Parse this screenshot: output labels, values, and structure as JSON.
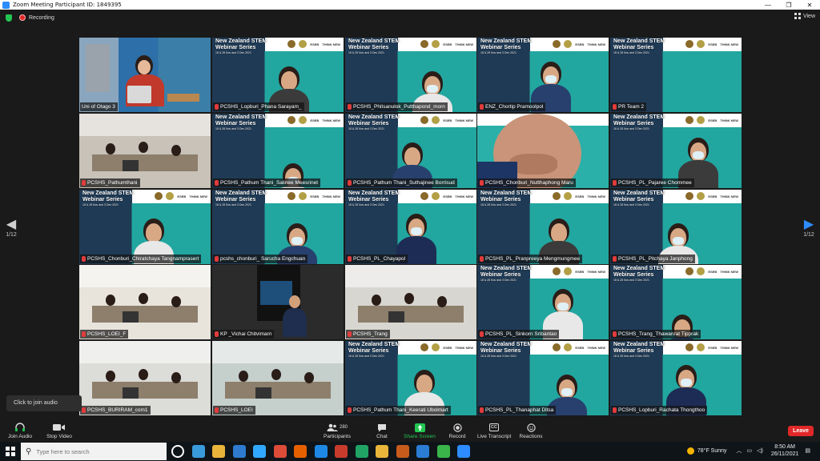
{
  "window": {
    "title": "Zoom Meeting Participant ID: 1849395",
    "controls": [
      "—",
      "❐",
      "✕"
    ]
  },
  "topbar": {
    "recording_label": "Recording",
    "view_label": "View"
  },
  "pagination": {
    "left_page": "1/12",
    "right_page": "1/12"
  },
  "slide": {
    "title_line1": "New Zealand STEM",
    "title_line2": "Webinar Series",
    "subtitle": "18 & 28 Nov and 3 Dec 2021",
    "logo_text": "ESEB",
    "logo_text2": "THINK NEW"
  },
  "participants": [
    {
      "name": "Uni of Otago 3",
      "active": true
    },
    {
      "name": "PCSHS_Lopburi_Phana Sarayam_"
    },
    {
      "name": "PCSHS_Phitsanulok_Putthapond_morn"
    },
    {
      "name": "ENZ_Chortip Pramoolpol"
    },
    {
      "name": "PR Team 2"
    },
    {
      "name": "PCSHS_Pathumthani"
    },
    {
      "name": "PCSHS_Pathum Thani_Salinee Meesrinet"
    },
    {
      "name": "PCSHS_Pathum Thani_Suthajinee Borrisud"
    },
    {
      "name": "PCSHS_Chonburi_Nutthaphong Maru"
    },
    {
      "name": "PCSHS_PL_Pajaree Chommee"
    },
    {
      "name": "PCSHS_Chonburi_Chiratchaya Tangnamprasert"
    },
    {
      "name": "pcshs_chonburi_ Sarucha Engchuan"
    },
    {
      "name": "PCSHS_PL_Chayapol"
    },
    {
      "name": "PCSHS_PL_Pranpreeya Mengmungmee"
    },
    {
      "name": "PCSHS_PL_Pitchaya Janphong"
    },
    {
      "name": "PCSHS_LOEI_F"
    },
    {
      "name": "KP _Vichai Chitvimarn"
    },
    {
      "name": "PCSHS_Trang"
    },
    {
      "name": "PCSHS_PL_Sinkorn Sribantao"
    },
    {
      "name": "PCSHS_Trang_Thawanrat Tipprak"
    },
    {
      "name": "PCSHS_BURIRAM_com1"
    },
    {
      "name": "PCSHS_LOEI"
    },
    {
      "name": "PCSHS_Pathum Thani_Keerati Ubolmart"
    },
    {
      "name": "PCSHS_PL_Thanaphat Ditsa"
    },
    {
      "name": "PCSHS_Lopburi_Rachata Thongthoo"
    }
  ],
  "tooltip": "Click to join audio",
  "toolbar": {
    "join_audio": "Join Audio",
    "stop_video": "Stop Video",
    "participants_count": "280",
    "participants": "Participants",
    "chat": "Chat",
    "share_screen": "Share Screen",
    "record": "Record",
    "live_transcript": "Live Transcript",
    "reactions": "Reactions",
    "leave": "Leave",
    "cc": "CC"
  },
  "taskbar": {
    "search_placeholder": "Type here to search",
    "weather": "78°F  Sunny",
    "time": "8:50 AM",
    "date": "26/11/2021",
    "app_colors": [
      "#ffffff",
      "#3a9bdc",
      "#e8b53a",
      "#2e7bcf",
      "#31a8ff",
      "#dd4b39",
      "#e66000",
      "#1e88e5",
      "#c73b2c",
      "#21a366",
      "#e8b53a",
      "#c65b1c",
      "#2b7cd3",
      "#39b54a",
      "#2d8cff"
    ]
  }
}
